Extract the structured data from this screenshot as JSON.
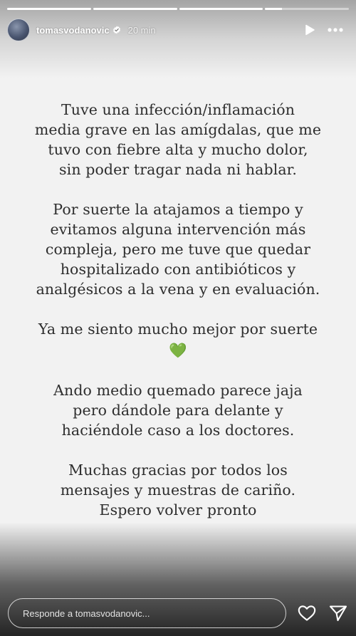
{
  "progress": {
    "segments": [
      1,
      1,
      1,
      0.2
    ]
  },
  "header": {
    "username": "tomasvodanovic",
    "time": "20 min",
    "avatar_icon": "user-avatar",
    "verified_icon": "verified-badge-icon",
    "play_icon": "play-icon",
    "more_icon": "more-options-icon"
  },
  "story": {
    "paragraphs": [
      {
        "lines": [
          "Tuve una infección/inflamación",
          "media grave en las amígdalas, que me",
          "tuvo con fiebre alta y mucho dolor,",
          "sin poder tragar nada ni hablar."
        ]
      },
      {
        "lines": [
          "Por suerte la atajamos a tiempo y",
          "evitamos alguna intervención más",
          "compleja, pero me tuve que quedar",
          "hospitalizado con antibióticos y",
          "analgésicos a la vena y en evaluación."
        ]
      },
      {
        "lines": [
          "Ya me siento mucho mejor por suerte"
        ],
        "emoji": "💚",
        "emoji_icon": "green-heart-emoji"
      },
      {
        "lines": [
          "Ando medio quemado parece jaja",
          "pero dándole para delante y",
          "haciéndole caso a los doctores."
        ]
      },
      {
        "lines": [
          "Muchas gracias por todos los",
          "mensajes y muestras de cariño.",
          "Espero volver pronto"
        ],
        "emoji": "🤞🏼",
        "emoji_icon": "crossed-fingers-emoji"
      }
    ]
  },
  "reply": {
    "placeholder": "Responde a tomasvodanovic...",
    "like_icon": "heart-outline-icon",
    "send_icon": "send-icon"
  },
  "colors": {
    "background": "#f2f2f2",
    "text": "#2e2e2e",
    "green_heart": "#3cba3c"
  }
}
